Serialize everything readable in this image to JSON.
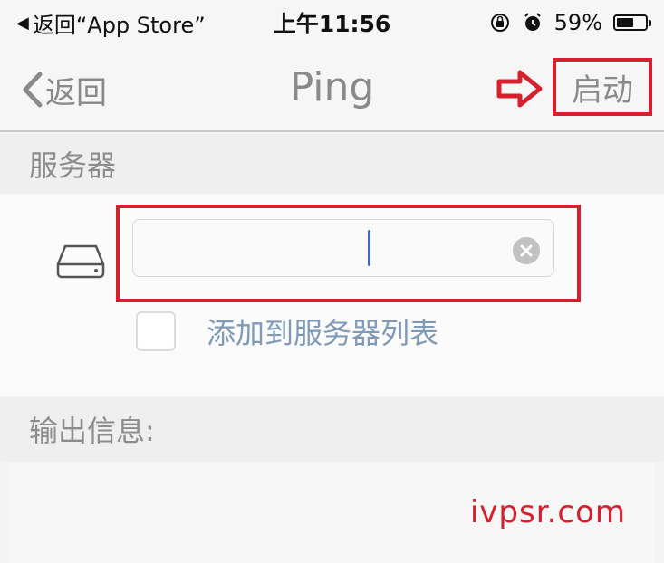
{
  "status_bar": {
    "back_app": "返回“App Store”",
    "time": "上午11:56",
    "battery_percent": "59%",
    "battery_level": 0.59
  },
  "nav": {
    "back_label": "返回",
    "title": "Ping",
    "start_label": "启动"
  },
  "server_section": {
    "header": "服务器",
    "input_value": "",
    "add_to_list_label": "添加到服务器列表",
    "add_to_list_checked": false
  },
  "output_section": {
    "header": "输出信息:",
    "content": ""
  },
  "watermark": "ivpsr.com",
  "colors": {
    "highlight": "#d6202e",
    "cursor": "#3f66c8",
    "link": "#7f9ab8"
  }
}
